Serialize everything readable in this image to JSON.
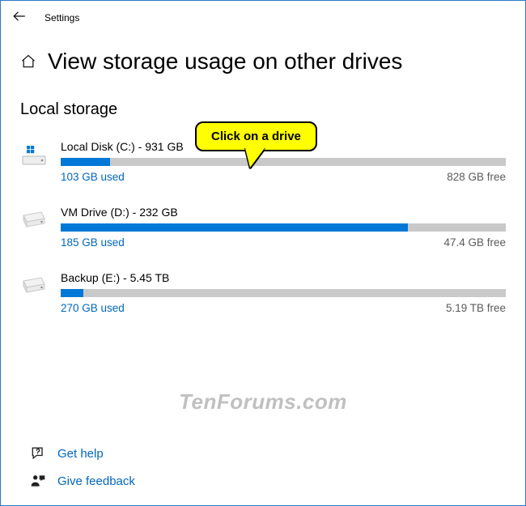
{
  "app_title": "Settings",
  "page_title": "View storage usage on other drives",
  "section": "Local storage",
  "callout": "Click on a drive",
  "watermark": "TenForums.com",
  "drives": [
    {
      "name": "Local Disk (C:) - 931 GB",
      "used": "103 GB used",
      "free": "828 GB free",
      "fill_pct": 11,
      "is_os": true
    },
    {
      "name": "VM Drive (D:) - 232 GB",
      "used": "185 GB used",
      "free": "47.4 GB free",
      "fill_pct": 78,
      "is_os": false
    },
    {
      "name": "Backup (E:) - 5.45 TB",
      "used": "270 GB used",
      "free": "5.19 TB free",
      "fill_pct": 5,
      "is_os": false
    }
  ],
  "links": {
    "help": "Get help",
    "feedback": "Give feedback"
  }
}
